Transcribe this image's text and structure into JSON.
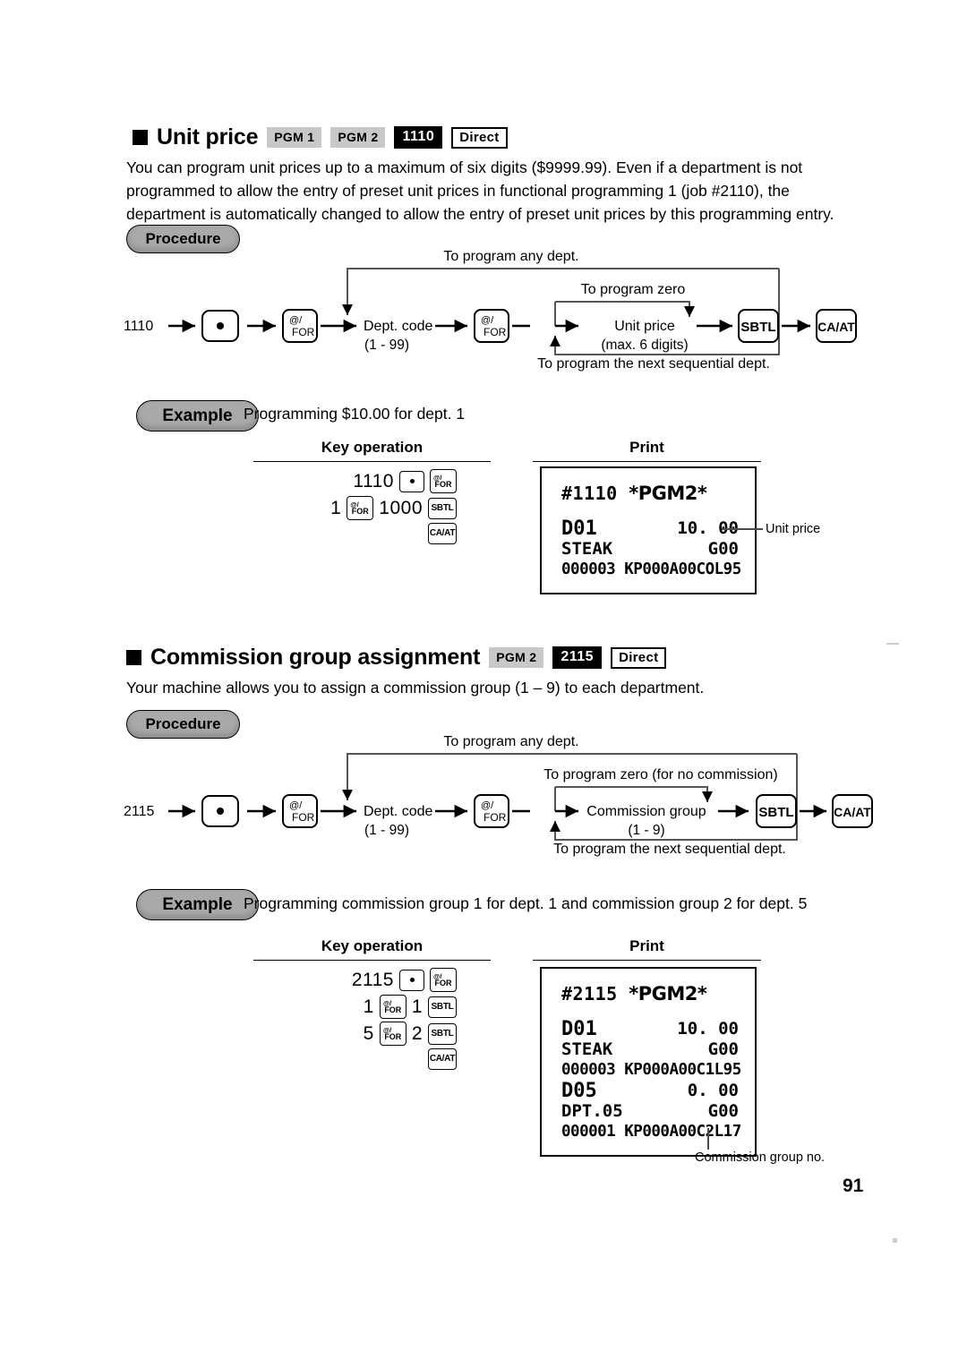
{
  "page": {
    "number": "91"
  },
  "sections": [
    {
      "id": "unit-price",
      "title": "Unit price",
      "badges": [
        {
          "label": "PGM 1",
          "style": "gray"
        },
        {
          "label": "PGM 2",
          "style": "gray"
        },
        {
          "label": "1110",
          "style": "black"
        },
        {
          "label": "Direct",
          "style": "outline"
        }
      ],
      "body": "You can program unit prices up to a maximum of six digits ($9999.99).  Even if a department is not programmed to allow the entry of preset unit prices in functional programming 1 (job #2110), the department is automatically changed to allow the entry of preset unit prices by this programming entry.",
      "procedure": {
        "label": "Procedure",
        "start_code": "1110",
        "keys": {
          "dot": "●",
          "for_top": "@/",
          "for_bottom": "FOR",
          "sbtl": "SBTL",
          "caat": "CA/AT"
        },
        "node_dept": "Dept. code",
        "node_dept_range": "(1 - 99)",
        "node_value": "Unit price",
        "node_value_note": "(max. 6 digits)",
        "loop_top": "To program any dept.",
        "loop_mid": "To program zero",
        "loop_bottom": "To program the next sequential dept."
      },
      "example": {
        "label": "Example",
        "text": "Programming $10.00 for dept. 1",
        "key_operation_header": "Key operation",
        "print_header": "Print",
        "key_rows": [
          [
            "1110",
            "dot",
            "for"
          ],
          [
            "1",
            "for",
            "1000",
            "sbtl"
          ],
          [
            "caat"
          ]
        ],
        "receipt": {
          "title_code": "#1110",
          "title_mode": "*PGM2*",
          "lines": [
            {
              "left": "D01",
              "right": "10. 00",
              "type": "dept"
            },
            {
              "left": "STEAK",
              "right": "G00",
              "type": "name"
            },
            {
              "left": "000003 KP000",
              "mid": "A00",
              "right": "COL95",
              "type": "detail"
            }
          ]
        },
        "callout": "Unit price"
      }
    },
    {
      "id": "commission-group-assignment",
      "title": "Commission group assignment",
      "badges": [
        {
          "label": "PGM 2",
          "style": "gray"
        },
        {
          "label": "2115",
          "style": "black"
        },
        {
          "label": "Direct",
          "style": "outline"
        }
      ],
      "body": "Your machine allows you to assign a commission group (1 – 9) to each department.",
      "procedure": {
        "label": "Procedure",
        "start_code": "2115",
        "keys": {
          "dot": "●",
          "for_top": "@/",
          "for_bottom": "FOR",
          "sbtl": "SBTL",
          "caat": "CA/AT"
        },
        "node_dept": "Dept. code",
        "node_dept_range": "(1 - 99)",
        "node_value": "Commission group",
        "node_value_note": "(1 - 9)",
        "loop_top": "To program any dept.",
        "loop_mid": "To program zero (for no commission)",
        "loop_bottom": "To program the next sequential dept."
      },
      "example": {
        "label": "Example",
        "text": "Programming commission group 1 for dept. 1 and commission group 2 for dept. 5",
        "key_operation_header": "Key operation",
        "print_header": "Print",
        "key_rows": [
          [
            "2115",
            "dot",
            "for"
          ],
          [
            "1",
            "for",
            "1",
            "sbtl"
          ],
          [
            "5",
            "for",
            "2",
            "sbtl"
          ],
          [
            "caat"
          ]
        ],
        "receipt": {
          "title_code": "#2115",
          "title_mode": "*PGM2*",
          "lines": [
            {
              "left": "D01",
              "right": "10. 00",
              "type": "dept"
            },
            {
              "left": "STEAK",
              "right": "G00",
              "type": "name"
            },
            {
              "left": "000003 KP000",
              "mid": "A00",
              "right": "C1L95",
              "type": "detail"
            },
            {
              "left": "D05",
              "right": "0. 00",
              "type": "dept"
            },
            {
              "left": "DPT.05",
              "right": "G00",
              "type": "name"
            },
            {
              "left": "000001 KP000",
              "mid": "A00",
              "right": "C2L17",
              "type": "detail"
            }
          ]
        },
        "callout": "Commission group no."
      }
    }
  ]
}
